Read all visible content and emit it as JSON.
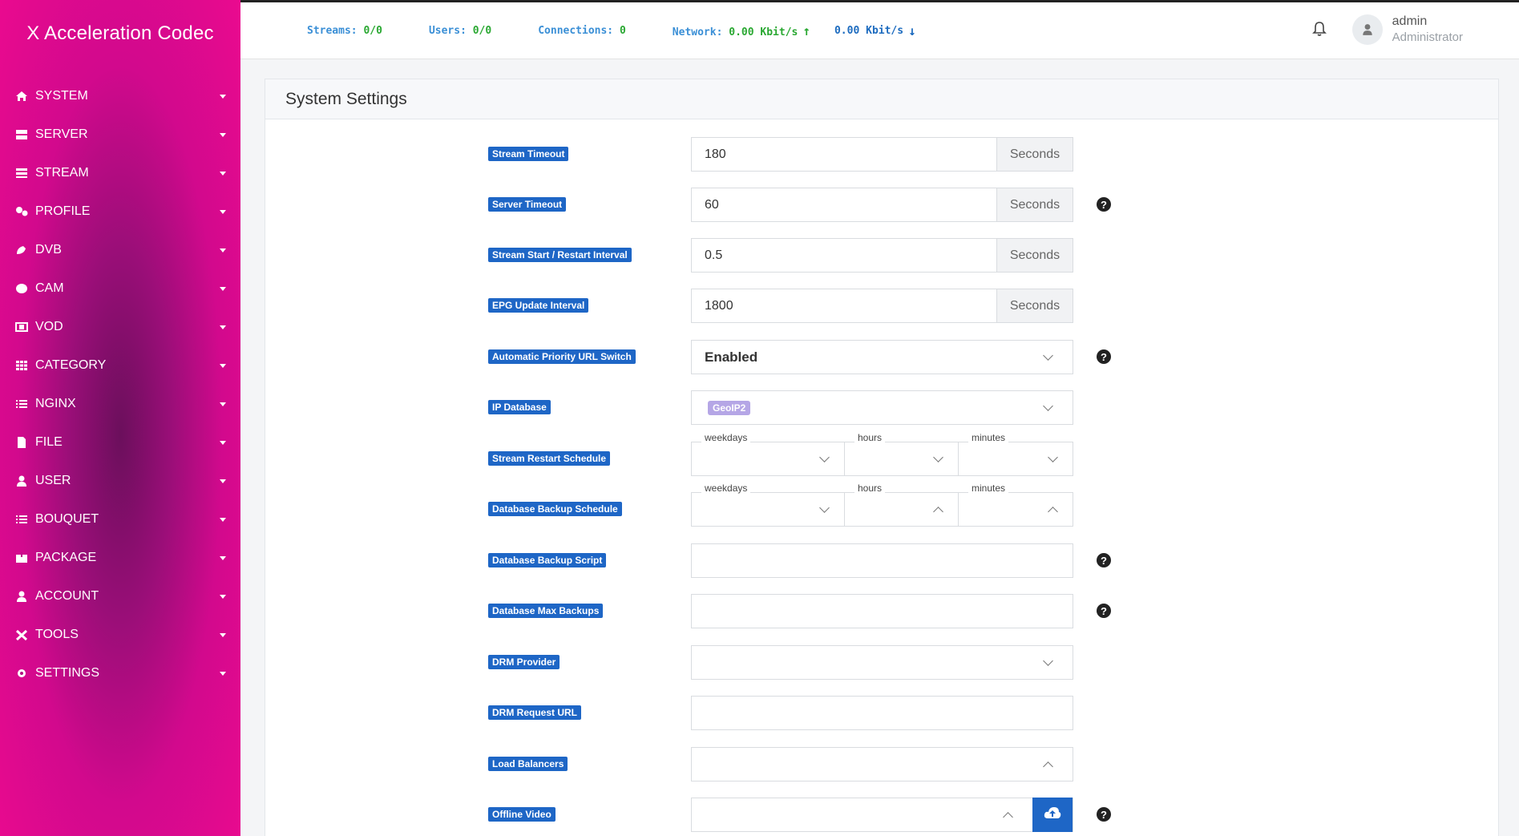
{
  "app": {
    "title": "X Acceleration Codec"
  },
  "sidebar": {
    "items": [
      {
        "label": "SYSTEM",
        "icon": "home-icon"
      },
      {
        "label": "SERVER",
        "icon": "server-icon"
      },
      {
        "label": "STREAM",
        "icon": "stream-icon"
      },
      {
        "label": "PROFILE",
        "icon": "profile-icon"
      },
      {
        "label": "DVB",
        "icon": "satellite-icon"
      },
      {
        "label": "CAM",
        "icon": "brain-icon"
      },
      {
        "label": "VOD",
        "icon": "film-icon"
      },
      {
        "label": "CATEGORY",
        "icon": "grid-icon"
      },
      {
        "label": "NGINX",
        "icon": "list-icon"
      },
      {
        "label": "FILE",
        "icon": "file-icon"
      },
      {
        "label": "USER",
        "icon": "user-icon"
      },
      {
        "label": "BOUQUET",
        "icon": "list-bullet-icon"
      },
      {
        "label": "PACKAGE",
        "icon": "box-icon"
      },
      {
        "label": "ACCOUNT",
        "icon": "account-icon"
      },
      {
        "label": "TOOLS",
        "icon": "tools-icon"
      },
      {
        "label": "SETTINGS",
        "icon": "gear-icon"
      }
    ]
  },
  "topbar": {
    "streams_label": "Streams:",
    "streams_value": "0/0",
    "users_label": "Users:",
    "users_value": "0/0",
    "connections_label": "Connections:",
    "connections_value": "0",
    "network_label": "Network:",
    "network_up": "0.00 Kbit/s",
    "network_down": "0.00 Kbit/s",
    "user_name": "admin",
    "user_role": "Administrator"
  },
  "page": {
    "title": "System Settings"
  },
  "form": {
    "stream_timeout": {
      "label": "Stream Timeout",
      "value": "180",
      "unit": "Seconds"
    },
    "server_timeout": {
      "label": "Server Timeout",
      "value": "60",
      "unit": "Seconds"
    },
    "restart_interval": {
      "label": "Stream Start / Restart Interval",
      "value": "0.5",
      "unit": "Seconds"
    },
    "epg_interval": {
      "label": "EPG Update Interval",
      "value": "1800",
      "unit": "Seconds"
    },
    "priority_switch": {
      "label": "Automatic Priority URL Switch",
      "value": "Enabled"
    },
    "ip_database": {
      "label": "IP Database",
      "value": "GeoIP2"
    },
    "restart_schedule": {
      "label": "Stream Restart Schedule",
      "weekdays": "weekdays",
      "hours": "hours",
      "minutes": "minutes"
    },
    "backup_schedule": {
      "label": "Database Backup Schedule",
      "weekdays": "weekdays",
      "hours": "hours",
      "minutes": "minutes"
    },
    "backup_script": {
      "label": "Database Backup Script",
      "value": ""
    },
    "max_backups": {
      "label": "Database Max Backups",
      "value": ""
    },
    "drm_provider": {
      "label": "DRM Provider",
      "value": ""
    },
    "drm_request_url": {
      "label": "DRM Request URL",
      "value": ""
    },
    "load_balancers": {
      "label": "Load Balancers",
      "value": ""
    },
    "offline_video": {
      "label": "Offline Video",
      "value": ""
    }
  },
  "help_glyph": "?",
  "colors": {
    "label_bg": "#1e66c6",
    "sidebar_pink": "#ea0a8f",
    "sidebar_purple": "#6b0f5c",
    "stat_blue": "#3a8fd6",
    "stat_green": "#2aa832"
  }
}
